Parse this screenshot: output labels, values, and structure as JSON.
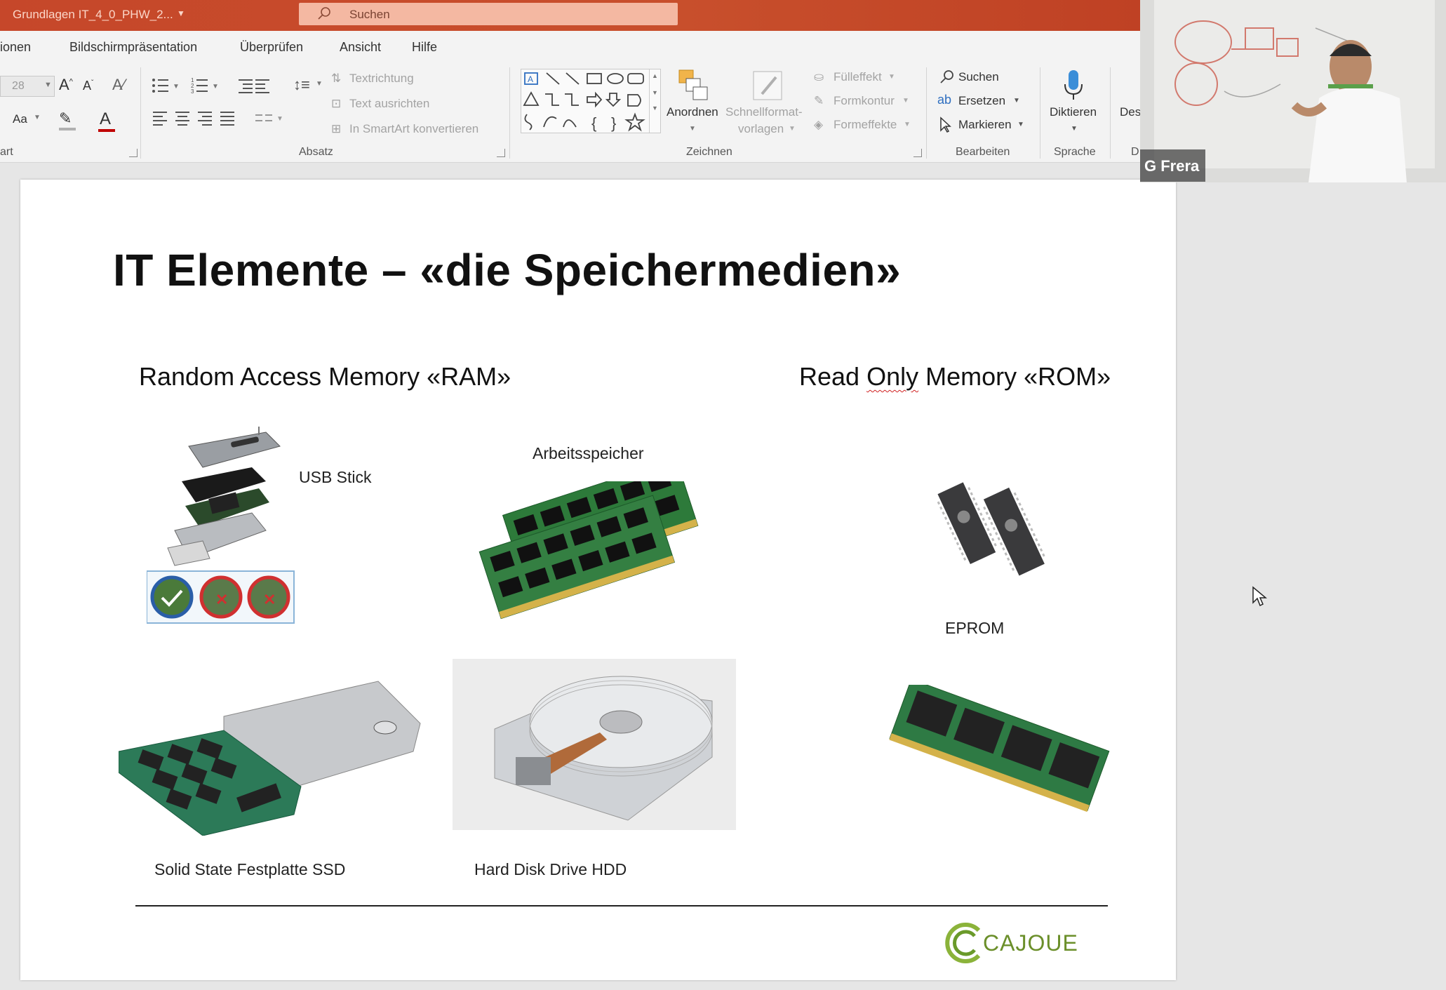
{
  "titlebar": {
    "doc_title": "Grundlagen IT_4_0_PHW_2...",
    "search_placeholder": "Suchen"
  },
  "tabs": [
    "ionen",
    "Bildschirmpräsentation",
    "Überprüfen",
    "Ansicht",
    "Hilfe"
  ],
  "ribbon": {
    "font": {
      "size_value": "28",
      "case_label": "Aa",
      "group_label": "art"
    },
    "paragraph": {
      "group_label": "Absatz",
      "text_direction": "Textrichtung",
      "align_text": "Text ausrichten",
      "smartart": "In SmartArt konvertieren"
    },
    "drawing": {
      "group_label": "Zeichnen",
      "arrange": "Anordnen",
      "quick_styles_1": "Schnellformat-",
      "quick_styles_2": "vorlagen",
      "shape_fill": "Fülleffekt",
      "shape_outline": "Formkontur",
      "shape_effects": "Formeffekte"
    },
    "editing": {
      "group_label": "Bearbeiten",
      "find": "Suchen",
      "replace": "Ersetzen",
      "select": "Markieren"
    },
    "voice": {
      "group_label": "Sprache",
      "dictate": "Diktieren"
    },
    "designer": {
      "label": "Des",
      "group_label": "D"
    }
  },
  "webcam": {
    "participant_name": "G Frera"
  },
  "slide": {
    "title": "IT Elemente – «die Speichermedien»",
    "ram_heading": "Random Access Memory «RAM»",
    "rom_heading_pre": "Read ",
    "rom_heading_wavy": "Only",
    "rom_heading_post": " Memory «ROM»",
    "captions": {
      "usb": "USB Stick",
      "ram": "Arbeitsspeicher",
      "eprom": "EPROM",
      "ssd": "Solid  State  Festplatte  SSD",
      "hdd": "Hard Disk Drive HDD"
    },
    "logo_text": "CAJOUE"
  }
}
